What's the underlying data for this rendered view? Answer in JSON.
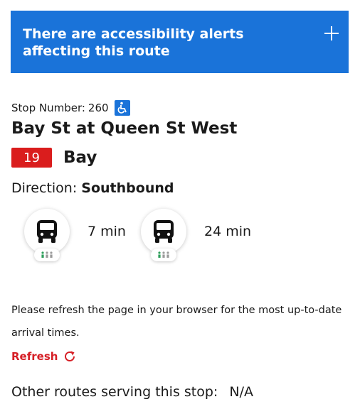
{
  "alert": {
    "text": "There are accessibility alerts affecting this route",
    "expand_icon": "plus-icon"
  },
  "stop": {
    "number_label": "Stop Number:",
    "number": "260",
    "accessible_icon": "wheelchair-icon",
    "name": "Bay St at Queen St West"
  },
  "route": {
    "number": "19",
    "name": "Bay"
  },
  "direction": {
    "label": "Direction:",
    "value": "Southbound"
  },
  "arrivals": [
    {
      "time": "7 min",
      "icon": "bus-icon",
      "crowding_icon": "crowding-icon"
    },
    {
      "time": "24 min",
      "icon": "bus-icon",
      "crowding_icon": "crowding-icon"
    }
  ],
  "notice": "Please refresh the page in your browser for the most up-to-date arrival times.",
  "refresh": {
    "label": "Refresh",
    "icon": "refresh-icon"
  },
  "other_routes": {
    "label": "Other routes serving this stop:",
    "value": "N/A"
  },
  "colors": {
    "alert_bg": "#1a73d9",
    "route_badge": "#da1d1d",
    "refresh": "#d61f26"
  }
}
